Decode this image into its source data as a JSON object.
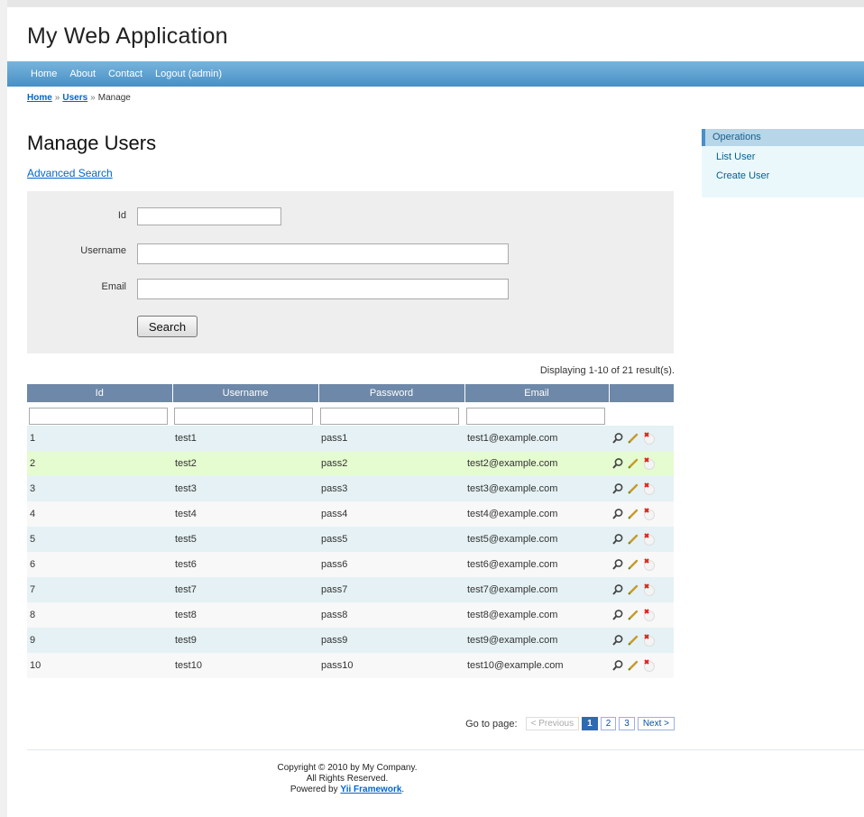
{
  "header": {
    "title": "My Web Application"
  },
  "mainmenu": {
    "items": [
      "Home",
      "About",
      "Contact",
      "Logout (admin)"
    ]
  },
  "breadcrumbs": {
    "home": "Home",
    "users": "Users",
    "current": "Manage",
    "separator": "»"
  },
  "page": {
    "title": "Manage Users",
    "advanced_search": "Advanced Search"
  },
  "search_form": {
    "fields": [
      {
        "label": "Id",
        "value": ""
      },
      {
        "label": "Username",
        "value": ""
      },
      {
        "label": "Email",
        "value": ""
      }
    ],
    "button_label": "Search"
  },
  "grid": {
    "summary": "Displaying 1-10 of 21 result(s).",
    "columns": [
      "Id",
      "Username",
      "Password",
      "Email"
    ],
    "rows": [
      {
        "id": "1",
        "username": "test1",
        "password": "pass1",
        "email": "test1@example.com"
      },
      {
        "id": "2",
        "username": "test2",
        "password": "pass2",
        "email": "test2@example.com"
      },
      {
        "id": "3",
        "username": "test3",
        "password": "pass3",
        "email": "test3@example.com"
      },
      {
        "id": "4",
        "username": "test4",
        "password": "pass4",
        "email": "test4@example.com"
      },
      {
        "id": "5",
        "username": "test5",
        "password": "pass5",
        "email": "test5@example.com"
      },
      {
        "id": "6",
        "username": "test6",
        "password": "pass6",
        "email": "test6@example.com"
      },
      {
        "id": "7",
        "username": "test7",
        "password": "pass7",
        "email": "test7@example.com"
      },
      {
        "id": "8",
        "username": "test8",
        "password": "pass8",
        "email": "test8@example.com"
      },
      {
        "id": "9",
        "username": "test9",
        "password": "pass9",
        "email": "test9@example.com"
      },
      {
        "id": "10",
        "username": "test10",
        "password": "pass10",
        "email": "test10@example.com"
      }
    ],
    "row_icons": [
      "view-icon",
      "update-icon",
      "delete-icon"
    ]
  },
  "pager": {
    "label": "Go to page:",
    "previous": "< Previous",
    "pages": [
      "1",
      "2",
      "3"
    ],
    "current": "1",
    "next": "Next >"
  },
  "sidebar": {
    "title": "Operations",
    "items": [
      "List User",
      "Create User"
    ]
  },
  "footer": {
    "line1": "Copyright © 2010 by My Company.",
    "line2": "All Rights Reserved.",
    "line3_prefix": "Powered by",
    "line3_link": "Yii Framework",
    "line3_suffix": "."
  },
  "colors": {
    "menu_bar": "#4890c6",
    "grid_header": "#6d88a8",
    "row_odd": "#e5f1f4",
    "row_even": "#f8f8f8",
    "row_selected": "#e5fbd0",
    "link": "#0066cc"
  }
}
